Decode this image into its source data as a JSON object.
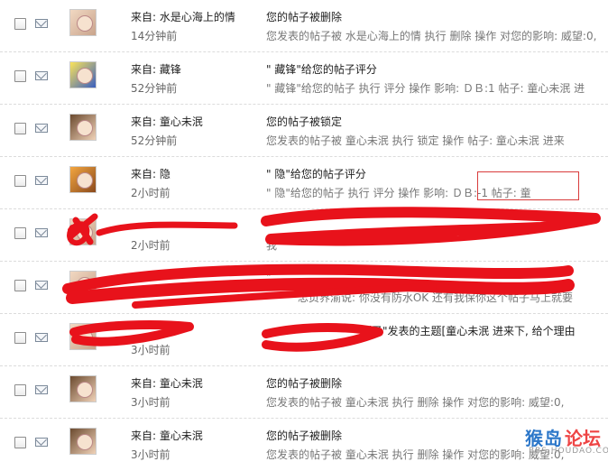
{
  "messages": [
    {
      "sender": "来自: 水是心海上的情",
      "time": "14分钟前",
      "subject": "您的帖子被删除",
      "snippet": "您发表的帖子被 水是心海上的情 执行 删除 操作 对您的影响: 威望:0,"
    },
    {
      "sender": "来自:    藏锋",
      "time": "52分钟前",
      "subject": "\"    藏锋\"给您的帖子评分",
      "snippet": "\"    藏锋\"给您的帖子 执行 评分 操作 影响: ＤＢ:1 帖子: 童心未泯 进"
    },
    {
      "sender": "来自:        童心未泯",
      "time": "52分钟前",
      "subject": "您的帖子被锁定",
      "snippet": "您发表的帖子被        童心未泯 执行 锁定 操作 帖子: 童心未泯 进来"
    },
    {
      "sender": "来自:                隐",
      "time": "2小时前",
      "subject": "\"                隐\"给您的帖子评分",
      "snippet": "\"                隐\"给您的帖子 执行 评分 操作 影响: ＤＢ:-1 帖子: 童"
    },
    {
      "sender": "",
      "time": "2小时前",
      "subject": "",
      "snippet": "我"
    },
    {
      "sender": "",
      "time": "",
      "subject": "\"",
      "snippet": "忠贞界渝说: 你没有防水OK 还有我保你这个帖子马上就要"
    },
    {
      "sender": "",
      "time": "3小时前",
      "subject": "剑圣\"发表的主题[童心未泯 进来下, 给个理由",
      "snippet": ""
    },
    {
      "sender": "来自:        童心未泯",
      "time": "3小时前",
      "subject": "您的帖子被删除",
      "snippet": "您发表的帖子被        童心未泯 执行 删除 操作 对您的影响: 威望:0,"
    },
    {
      "sender": "来自:        童心未泯",
      "time": "3小时前",
      "subject": "您的帖子被删除",
      "snippet": "您发表的帖子被        童心未泯 执行 删除 操作 对您的影响: 威望:0,"
    }
  ],
  "watermark": {
    "site": "猴岛论坛",
    "part1": "猴岛",
    "part2": "论坛",
    "url": "BBS.HOUDAO.COM"
  },
  "colors": {
    "scribble": "#e8121b",
    "highlight_box": "#d93c3c"
  }
}
